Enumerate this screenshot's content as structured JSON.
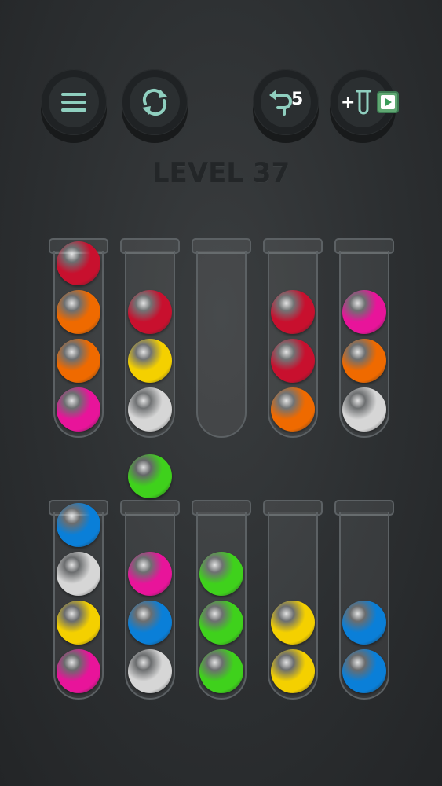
{
  "level_label": "LEVEL 37",
  "undo_count": "5",
  "add_tube_label": "+",
  "colors": {
    "red": "#c8102e",
    "orange": "#ef6a00",
    "pink": "#e8149a",
    "yellow": "#f4d000",
    "white": "#d6d6d6",
    "green": "#3fd11c",
    "blue": "#0a7fd8"
  },
  "tubes_top": [
    [
      "red",
      "orange",
      "orange",
      "pink"
    ],
    [
      "red",
      "yellow",
      "white"
    ],
    [],
    [
      "red",
      "red",
      "orange"
    ],
    [
      "pink",
      "orange",
      "white"
    ]
  ],
  "tubes_bottom": [
    [
      "blue",
      "white",
      "yellow",
      "pink"
    ],
    [
      "pink",
      "blue",
      "white"
    ],
    [
      "green",
      "green",
      "green"
    ],
    [
      "yellow",
      "yellow"
    ],
    [
      "blue",
      "blue"
    ]
  ],
  "held_ball": "green"
}
